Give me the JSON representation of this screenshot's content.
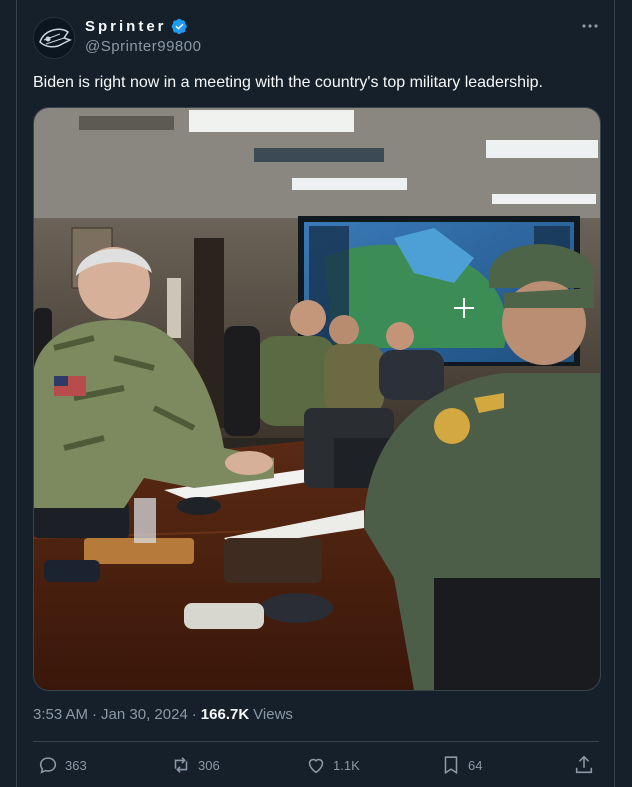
{
  "author": {
    "display_name": "Sprinter",
    "handle": "@Sprinter99800",
    "verified": true,
    "verified_color": "#1d9bf0"
  },
  "tweet": {
    "text": "Biden is right now in a meeting with the country's top military leadership.",
    "time": "3:53 AM",
    "separator": "·",
    "date": "Jan 30, 2024",
    "separator2": "·",
    "views_count": "166.7K",
    "views_label": "Views"
  },
  "actions": {
    "replies": "363",
    "reposts": "306",
    "likes": "1.1K",
    "bookmarks": "64"
  },
  "icons": [
    "more-icon",
    "verified-icon",
    "reply-icon",
    "repost-icon",
    "like-icon",
    "bookmark-icon",
    "share-icon"
  ],
  "colors": {
    "background": "#15202b",
    "text_primary": "#f7f9f9",
    "text_secondary": "#8b98a5",
    "border": "#38444d"
  }
}
